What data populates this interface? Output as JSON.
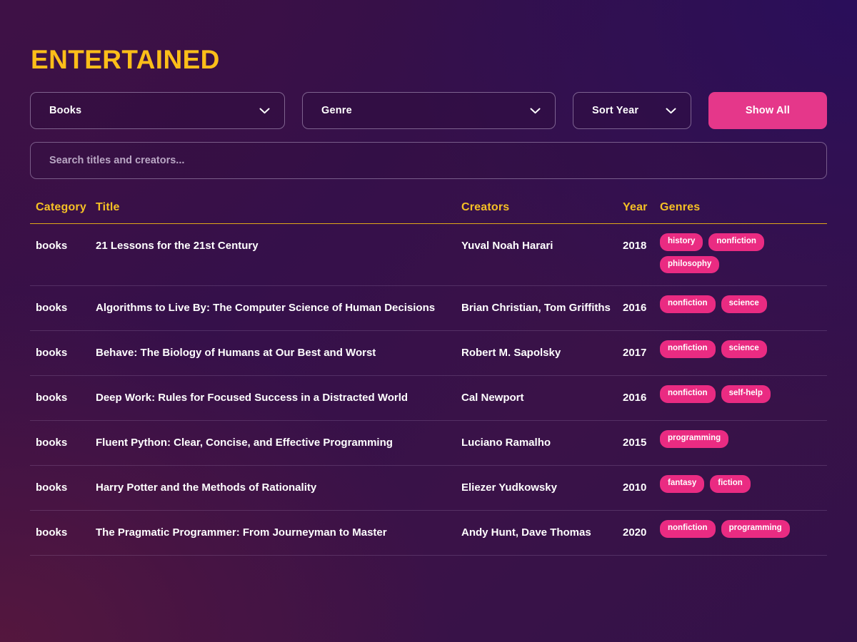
{
  "app": {
    "logo": "ENTERTAINED",
    "accent_gold": "#fcbe19",
    "accent_pink": "#e5378a",
    "chip_pink": "#ea2b82",
    "background_start": "#3b1144",
    "background_end": "#331149"
  },
  "filters": {
    "category": {
      "label": "Books",
      "icon": "chevron-down-icon"
    },
    "genre": {
      "label": "Genre",
      "icon": "chevron-down-icon"
    },
    "sort": {
      "label": "Sort Year",
      "icon": "chevron-down-icon"
    },
    "show_all": "Show All"
  },
  "search": {
    "value": "",
    "placeholder": "Search titles and creators..."
  },
  "table": {
    "columns": [
      "Category",
      "Title",
      "Creators",
      "Year",
      "Genres"
    ],
    "rows": [
      {
        "category": "books",
        "title": "21 Lessons for the 21st Century",
        "creators": "Yuval Noah Harari",
        "year": "2018",
        "genres": [
          "history",
          "nonfiction",
          "philosophy"
        ]
      },
      {
        "category": "books",
        "title": "Algorithms to Live By: The Computer Science of Human Decisions",
        "creators": "Brian Christian, Tom Griffiths",
        "year": "2016",
        "genres": [
          "nonfiction",
          "science"
        ]
      },
      {
        "category": "books",
        "title": "Behave: The Biology of Humans at Our Best and Worst",
        "creators": "Robert M. Sapolsky",
        "year": "2017",
        "genres": [
          "nonfiction",
          "science"
        ]
      },
      {
        "category": "books",
        "title": "Deep Work: Rules for Focused Success in a Distracted World",
        "creators": "Cal Newport",
        "year": "2016",
        "genres": [
          "nonfiction",
          "self-help"
        ]
      },
      {
        "category": "books",
        "title": "Fluent Python: Clear, Concise, and Effective Programming",
        "creators": "Luciano Ramalho",
        "year": "2015",
        "genres": [
          "programming"
        ]
      },
      {
        "category": "books",
        "title": "Harry Potter and the Methods of Rationality",
        "creators": "Eliezer Yudkowsky",
        "year": "2010",
        "genres": [
          "fantasy",
          "fiction"
        ]
      },
      {
        "category": "books",
        "title": "The Pragmatic Programmer: From Journeyman to Master",
        "creators": "Andy Hunt, Dave Thomas",
        "year": "2020",
        "genres": [
          "nonfiction",
          "programming"
        ]
      }
    ]
  }
}
